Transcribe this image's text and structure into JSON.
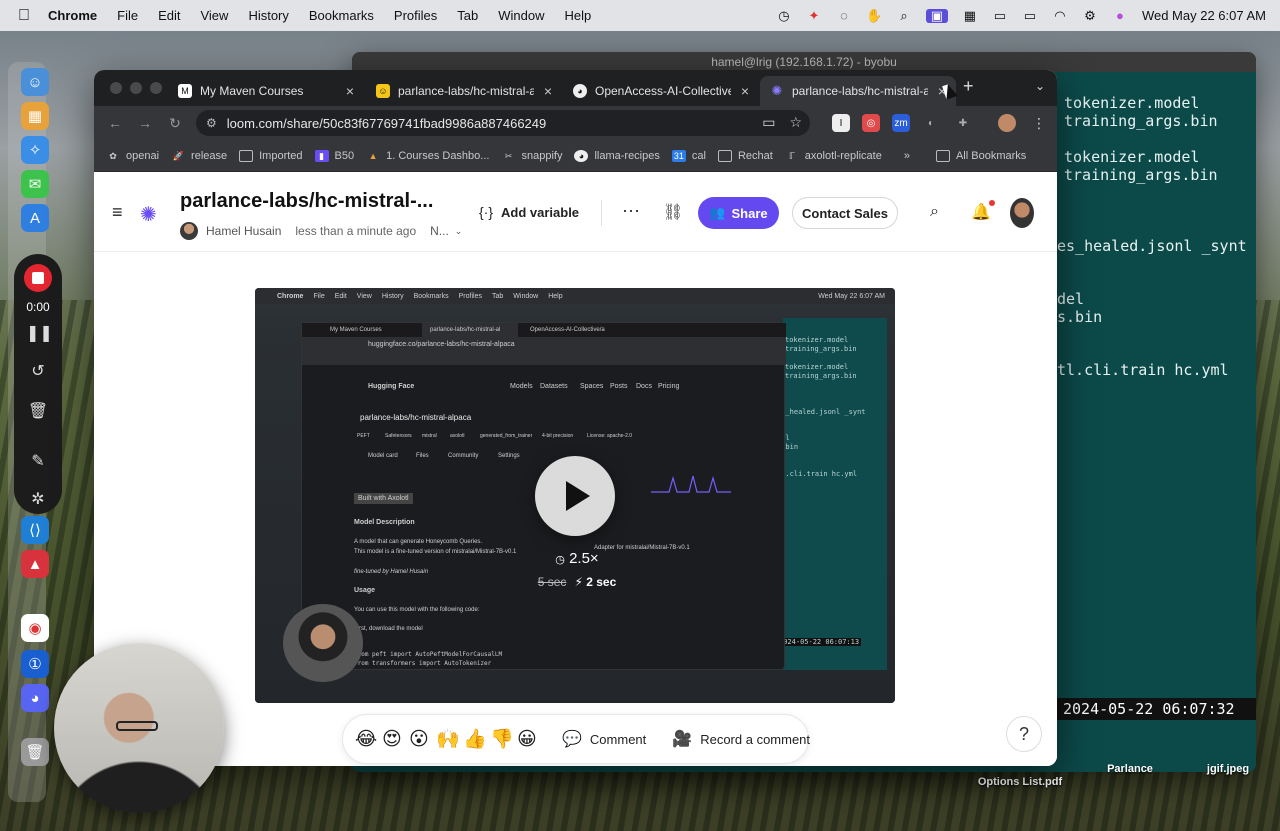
{
  "menubar": {
    "app": "Chrome",
    "items": [
      "File",
      "Edit",
      "View",
      "History",
      "Bookmarks",
      "Profiles",
      "Tab",
      "Window",
      "Help"
    ],
    "datetime": "Wed May 22  6:07 AM"
  },
  "terminal": {
    "title": "hamel@lrig (192.168.1.72) - byobu",
    "lines": [
      "tokenizer.model",
      "training_args.bin",
      "tokenizer.model",
      "training_args.bin",
      "es_healed.jsonl _synt",
      "del",
      "s.bin",
      "tl.cli.train hc.yml"
    ],
    "status": "2024-05-22 06:07:32",
    "desktop_labels": [
      "Parlance",
      "jgif.jpeg",
      "Options List.pdf"
    ]
  },
  "recorder": {
    "time": "0:00"
  },
  "browser": {
    "tabs": [
      {
        "title": "My Maven Courses",
        "icon": "maven-icon"
      },
      {
        "title": "parlance-labs/hc-mistral-alp",
        "icon": "huggingface-icon"
      },
      {
        "title": "OpenAccess-AI-Collective/a",
        "icon": "github-icon"
      },
      {
        "title": "parlance-labs/hc-mistral-alp",
        "icon": "loom-icon"
      }
    ],
    "url": "loom.com/share/50c83f67769741fbad9986a887466249",
    "bookmarks": [
      "openai",
      "release",
      "Imported",
      "B50",
      "1. Courses Dashbo...",
      "snappify",
      "llama-recipes",
      "cal",
      "Rechat",
      "axolotl-replicate"
    ],
    "all_bookmarks": "All Bookmarks"
  },
  "loom": {
    "title": "parlance-labs/hc-mistral-...",
    "author": "Hamel Husain",
    "time": "less than a minute ago",
    "folder": "N...",
    "add_variable": "Add variable",
    "share": "Share",
    "contact_sales": "Contact Sales",
    "accent": "#6549f0",
    "video": {
      "speed": "2.5×",
      "old_time": "5 sec",
      "new_time": "2 sec",
      "inner_menu": [
        "Chrome",
        "File",
        "Edit",
        "View",
        "History",
        "Bookmarks",
        "Profiles",
        "Tab",
        "Window",
        "Help"
      ],
      "inner_date": "Wed May 22  6:07 AM",
      "inner_tabs": [
        "My Maven Courses",
        "parlance-labs/hc-mistral-al",
        "OpenAccess-AI-Collective/a"
      ],
      "inner_url": "huggingface.co/parlance-labs/hc-mistral-alpaca",
      "hf_brand": "Hugging Face",
      "hf_nav": [
        "Models",
        "Datasets",
        "Spaces",
        "Posts",
        "Docs",
        "Pricing"
      ],
      "repo": "parlance-labs/hc-mistral-alpaca",
      "tags": [
        "PEFT",
        "Safetensors",
        "mistral",
        "axolotl",
        "generated_from_trainer",
        "4-bit precision",
        "License: apache-2.0"
      ],
      "model_tabs": [
        "Model card",
        "Files",
        "Community",
        "Settings"
      ],
      "axolotl_badge": "Built with Axolotl",
      "model_desc_heading": "Model Description",
      "desc1": "A model that can generate Honeycomb Queries.",
      "desc2": "This model is a fine-tuned version of mistralai/Mistral-7B-v0.1",
      "finetuned": "fine-tuned by Hamel Husain",
      "usage": "Usage",
      "usage_text": "You can use this model with the following code:",
      "download": "First, download the model",
      "code1": "from peft import AutoPeftModelForCausalLM",
      "code2": "from transformers import AutoTokenizer",
      "adapter": "Adapter for mistralai/Mistral-7B-v0.1",
      "term_lines": [
        "tokenizer.model",
        "training_args.bin",
        "tokenizer.model",
        "training_args.bin",
        "es_healed.jsonl _synt",
        "del",
        "s.bin",
        "tl.cli.train hc.yml"
      ],
      "term_status": "2024-05-22 06:07:13"
    },
    "reactions": [
      "😂",
      "😍",
      "😮",
      "🙌",
      "👍",
      "👎",
      "😀"
    ],
    "comment": "Comment",
    "record_comment": "Record a comment",
    "help": "?"
  }
}
